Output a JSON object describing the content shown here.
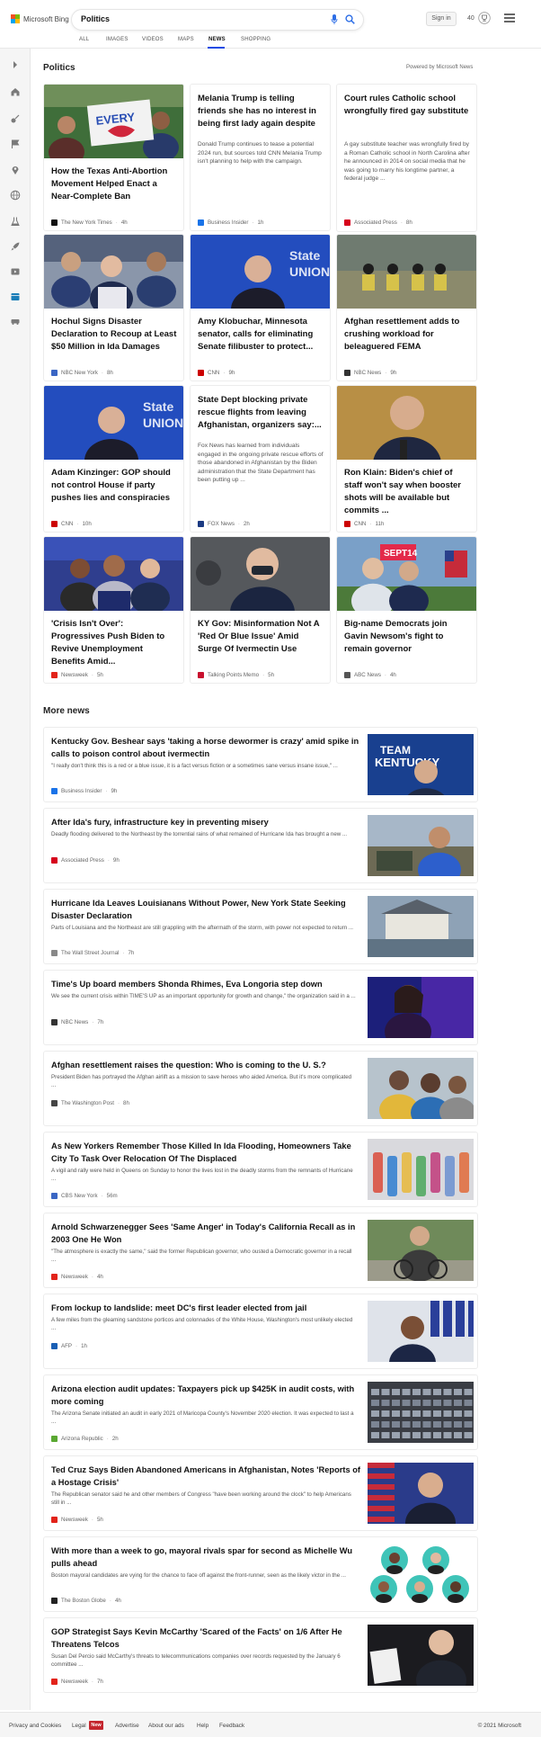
{
  "header": {
    "logo_text": "Microsoft Bing",
    "search_value": "Politics",
    "signin_label": "Sign in",
    "points": "40"
  },
  "nav": [
    "ALL",
    "IMAGES",
    "VIDEOS",
    "MAPS",
    "NEWS",
    "SHOPPING"
  ],
  "nav_active": "NEWS",
  "rail_icons": [
    "expand-icon",
    "home-icon",
    "sports-icon",
    "flag-icon",
    "location-icon",
    "globe-icon",
    "science-icon",
    "rocket-icon",
    "entertainment-icon",
    "money-icon",
    "car-icon"
  ],
  "section": {
    "title": "Politics",
    "powered_by": "Powered by Microsoft News"
  },
  "cards": [
    {
      "title": "How the Texas Anti-Abortion Movement Helped Enact a Near-Complete Ban",
      "source": "The New York Times",
      "age": "4h",
      "src_color": "#111111"
    },
    {
      "title": "Melania Trump is telling friends she has no interest in being first lady again despite her...",
      "snippet": "Donald Trump continues to tease a potential 2024 run, but sources told CNN Melania Trump isn't planning to help with the campaign.",
      "source": "Business Insider",
      "age": "1h",
      "src_color": "#1a73e8"
    },
    {
      "title": "Court rules Catholic school wrongfully fired gay substitute",
      "snippet": "A gay substitute teacher was wrongfully fired by a Roman Catholic school in North Carolina after he announced in 2014 on social media that he was going to marry his longtime partner, a federal judge ...",
      "source": "Associated Press",
      "age": "8h",
      "src_color": "#d6001c"
    },
    {
      "title": "Hochul Signs Disaster Declaration to Recoup at Least $50 Million in Ida Damages",
      "source": "NBC New York",
      "age": "8h",
      "src_color": "#3a66c4"
    },
    {
      "title": "Amy Klobuchar, Minnesota senator, calls for eliminating Senate filibuster to protect...",
      "source": "CNN",
      "age": "9h",
      "src_color": "#cc0000"
    },
    {
      "title": "Afghan resettlement adds to crushing workload for beleaguered FEMA",
      "source": "NBC News",
      "age": "9h",
      "src_color": "#333333"
    },
    {
      "title": "Adam Kinzinger: GOP should not control House if party pushes lies and conspiracies",
      "source": "CNN",
      "age": "10h",
      "src_color": "#cc0000"
    },
    {
      "title": "State Dept blocking private rescue flights from leaving Afghanistan, organizers say:...",
      "snippet": "Fox News has learned from individuals engaged in the ongoing private rescue efforts of those abandoned in Afghanistan by the Biden administration that the State Department has been putting up ...",
      "source": "FOX News",
      "age": "2h",
      "src_color": "#1b3a82"
    },
    {
      "title": "Ron Klain: Biden's chief of staff won't say when booster shots will be available but commits ...",
      "source": "CNN",
      "age": "11h",
      "src_color": "#cc0000"
    },
    {
      "title": "'Crisis Isn't Over': Progressives Push Biden to Revive Unemployment Benefits Amid...",
      "source": "Newsweek",
      "age": "5h",
      "src_color": "#e2231a"
    },
    {
      "title": "KY Gov: Misinformation Not A 'Red Or Blue Issue' Amid Surge Of Ivermectin Use",
      "source": "Talking Points Memo",
      "age": "5h",
      "src_color": "#c8102e"
    },
    {
      "title": "Big-name Democrats join Gavin Newsom's fight to remain governor",
      "source": "ABC News",
      "age": "4h",
      "src_color": "#555555"
    }
  ],
  "more_news": {
    "title": "More news",
    "items": [
      {
        "title": "Kentucky Gov. Beshear says 'taking a horse dewormer is crazy' amid spike in calls to poison control about ivermectin",
        "snippet": "\"I really don't think this is a red or a blue issue, it is a fact versus fiction or a sometimes sane versus insane issue,\" ...",
        "source": "Business Insider",
        "age": "9h",
        "src_color": "#1a73e8",
        "img_text": "TEAM KENTUCKY"
      },
      {
        "title": "After Ida's fury, infrastructure key in preventing misery",
        "snippet": "Deadly flooding delivered to the Northeast by the torrential rains of what remained of Hurricane Ida has brought a new ...",
        "source": "Associated Press",
        "age": "9h",
        "src_color": "#d6001c"
      },
      {
        "title": "Hurricane Ida Leaves Louisianans Without Power, New York State Seeking Disaster Declaration",
        "snippet": "Parts of Louisiana and the Northeast are still grappling with the aftermath of the storm, with power not expected to return ...",
        "source": "The Wall Street Journal",
        "age": "7h",
        "src_color": "#888888"
      },
      {
        "title": "Time's Up board members Shonda Rhimes, Eva Longoria step down",
        "snippet": "We see the current crisis within TIME'S UP as an important opportunity for growth and change,\" the organization said in a ...",
        "source": "NBC News",
        "age": "7h",
        "src_color": "#333333"
      },
      {
        "title": "Afghan resettlement raises the question: Who is coming to the U. S.?",
        "snippet": "President Biden has portrayed the Afghan airlift as a mission to save heroes who aided America. But it's more complicated ...",
        "source": "The Washington Post",
        "age": "8h",
        "src_color": "#444444"
      },
      {
        "title": "As New Yorkers Remember Those Killed In Ida Flooding, Homeowners Take City To Task Over Relocation Of The Displaced",
        "snippet": "A vigil and rally were held in Queens on Sunday to honor the lives lost in the deadly storms from the remnants of Hurricane ...",
        "source": "CBS New York",
        "age": "56m",
        "src_color": "#3a66c4"
      },
      {
        "title": "Arnold Schwarzenegger Sees 'Same Anger' in Today's California Recall as in 2003 One He Won",
        "snippet": "\"The atmosphere is exactly the same,\" said the former Republican governor, who ousted a Democratic governor in a recall ...",
        "source": "Newsweek",
        "age": "4h",
        "src_color": "#e2231a"
      },
      {
        "title": "From lockup to landslide: meet DC's first leader elected from jail",
        "snippet": "A few miles from the gleaming sandstone porticos and colonnades of the White House, Washington's most unlikely elected ...",
        "source": "AFP",
        "age": "1h",
        "src_color": "#1a5fb4"
      },
      {
        "title": "Arizona election audit updates: Taxpayers pick up $425K in audit costs, with more coming",
        "snippet": "The Arizona Senate initiated an audit in early 2021 of Maricopa County's November 2020 election. It was expected to last a ...",
        "source": "Arizona Republic",
        "age": "2h",
        "src_color": "#5aa832"
      },
      {
        "title": "Ted Cruz Says Biden Abandoned Americans in Afghanistan, Notes 'Reports of a Hostage Crisis'",
        "snippet": "The Republican senator said he and other members of Congress \"have been working around the clock\" to help Americans still in ...",
        "source": "Newsweek",
        "age": "5h",
        "src_color": "#e2231a"
      },
      {
        "title": "With more than a week to go, mayoral rivals spar for second as Michelle Wu pulls ahead",
        "snippet": "Boston mayoral candidates are vying for the chance to face off against the front-runner, seen as the likely victor in the ...",
        "source": "The Boston Globe",
        "age": "4h",
        "src_color": "#222222"
      },
      {
        "title": "GOP Strategist Says Kevin McCarthy 'Scared of the Facts' on 1/6 After He Threatens Telcos",
        "snippet": "Susan Del Percio said McCarthy's threats to telecommunications companies over records requested by the January 6 committee ...",
        "source": "Newsweek",
        "age": "7h",
        "src_color": "#e2231a"
      }
    ]
  },
  "footer": {
    "links": [
      "Privacy and Cookies",
      "Legal",
      "Advertise",
      "About our ads",
      "Help",
      "Feedback"
    ],
    "new_badge": "New",
    "copyright": "© 2021 Microsoft"
  }
}
